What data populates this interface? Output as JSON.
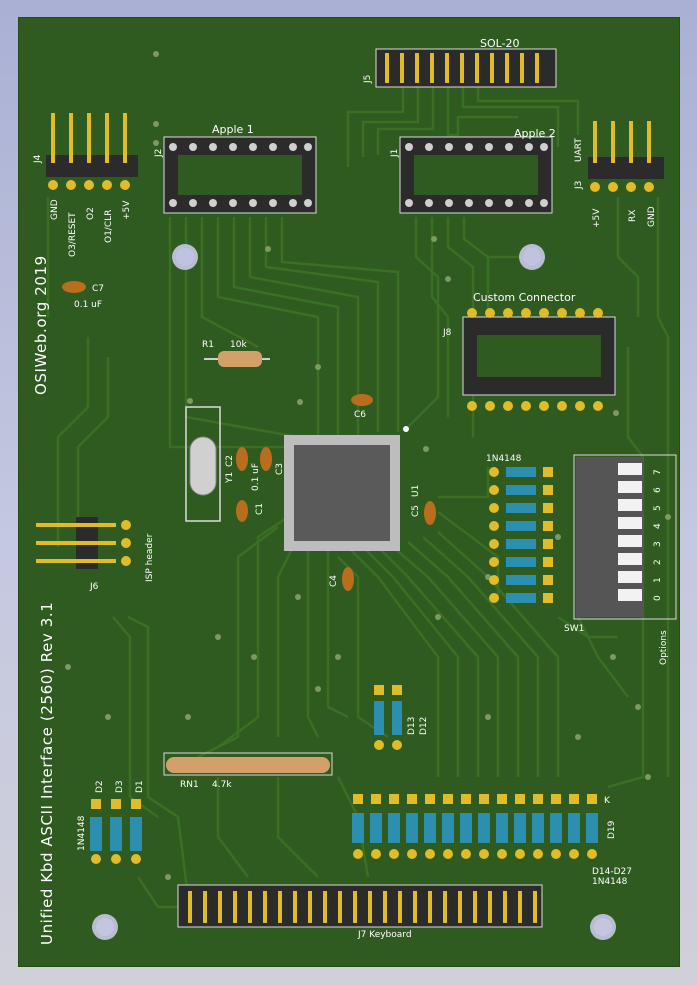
{
  "board": {
    "colors": {
      "backdrop": "#bdbfd6",
      "pcb": "#2f5a20",
      "trace": "#3b7125",
      "silk": "#ffffff",
      "pad": "#e0bc2a",
      "drill": "#3a3a3a",
      "chip": "#5a5a5a",
      "resistor": "#d4a06a",
      "diode": "#2d8fb0",
      "cap": "#b86e1c",
      "header": "#333333"
    },
    "title_vertical": "Unified Kbd ASCII Interface (2560) Rev 3.1",
    "credit_vertical": "OSIWeb.org 2019",
    "connectors": {
      "sol20": "SOL-20",
      "j5": "J5",
      "apple1": "Apple 1",
      "j2": "J2",
      "apple2": "Apple 2",
      "j1": "J1",
      "custom": "Custom Connector",
      "j8": "J8",
      "j4": "J4",
      "j3": "J3",
      "uart": "UART",
      "isp": "ISP header",
      "j6": "J6",
      "j7": "J7 Keyboard"
    },
    "j4_pins": [
      "GND",
      "O3/RESET",
      "O2",
      "O1/CLR",
      "+5V"
    ],
    "j3_pins": [
      "+5V",
      "RX",
      "GND"
    ],
    "components": {
      "c7": "C7",
      "c7_value": "0.1 uF",
      "r1": "R1",
      "r1_value": "10k",
      "c6": "C6",
      "c2": "C2",
      "c2_value": "0.1 uF",
      "c3": "C3",
      "y1": "Y1",
      "c1": "C1",
      "c4": "C4",
      "c5": "C5",
      "u1": "U1",
      "rn1": "RN1",
      "rn1_value": "4.7k",
      "d2": "D2",
      "d3": "D3",
      "d1": "D1",
      "diode_type": "1N4148",
      "d13": "D13",
      "d12": "D12",
      "k": "K",
      "d19": "D19",
      "d14_d27": "D14-D27",
      "d14_type": "1N4148",
      "diode_array_type": "1N4148",
      "sw1": "SW1",
      "options": "Options"
    },
    "sw1_positions": [
      "0",
      "1",
      "2",
      "3",
      "4",
      "5",
      "6",
      "7"
    ]
  }
}
